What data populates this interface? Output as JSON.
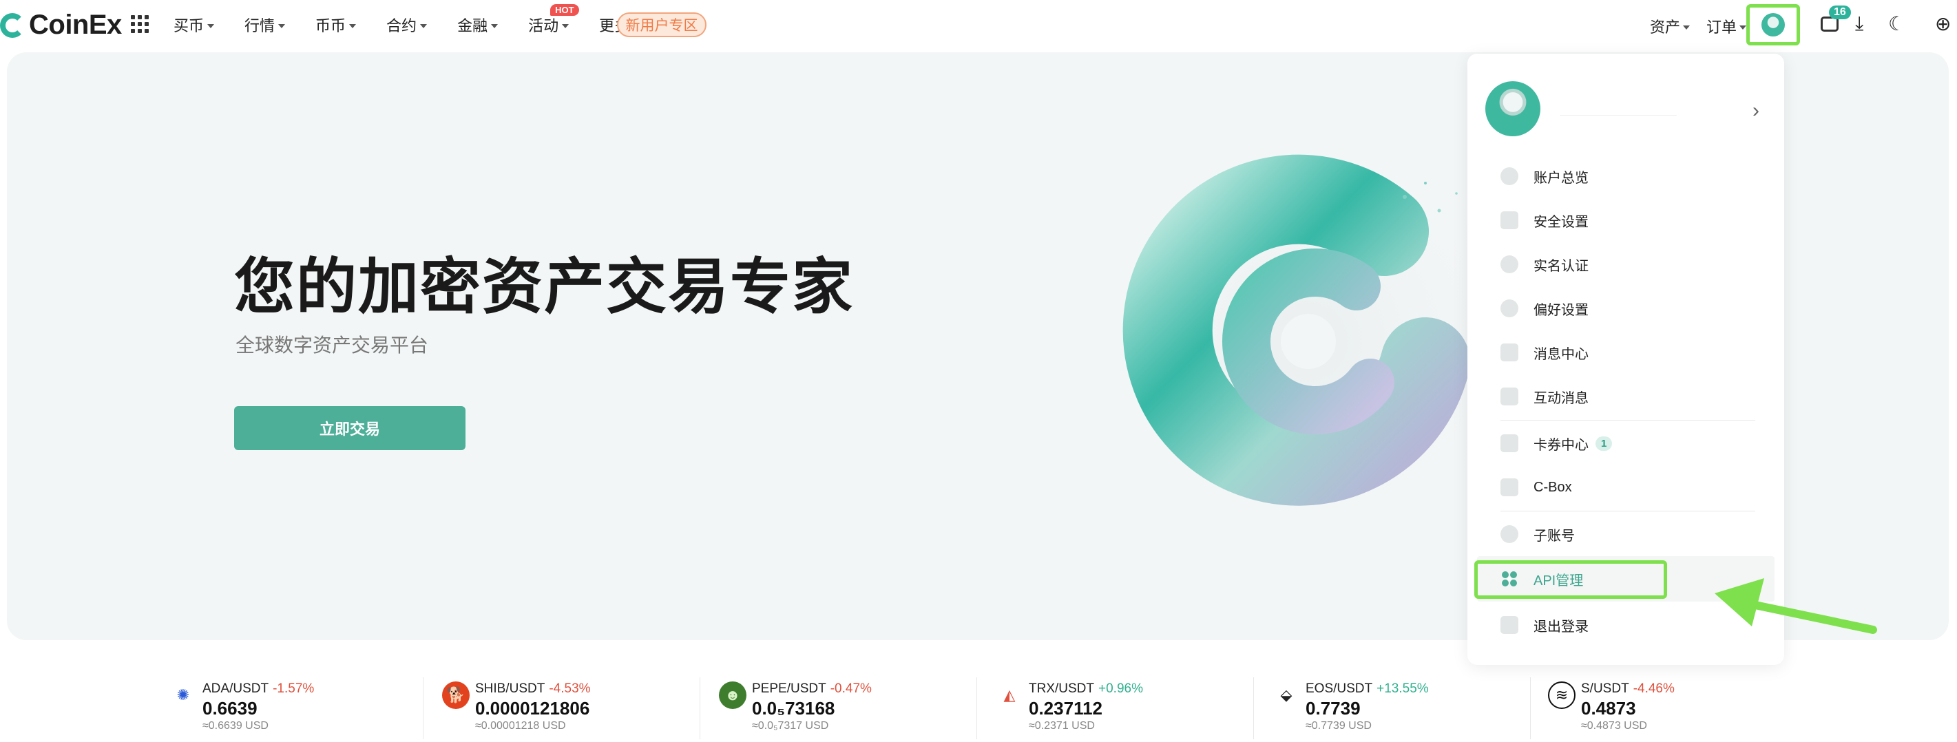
{
  "brand": {
    "name": "CoinEx"
  },
  "nav": {
    "items": [
      {
        "label": "买币"
      },
      {
        "label": "行情"
      },
      {
        "label": "币币"
      },
      {
        "label": "合约"
      },
      {
        "label": "金融"
      },
      {
        "label": "活动",
        "badge": "HOT"
      },
      {
        "label": "更多"
      }
    ],
    "promo": "新用户专区",
    "right": {
      "assets": "资产",
      "orders": "订单",
      "messages_count": "16"
    }
  },
  "hero": {
    "title": "您的加密资产交易专家",
    "subtitle": "全球数字资产交易平台",
    "cta": "立即交易"
  },
  "dropdown": {
    "items": [
      {
        "label": "账户总览",
        "icon": "account-overview-icon"
      },
      {
        "label": "安全设置",
        "icon": "security-shield-icon"
      },
      {
        "label": "实名认证",
        "icon": "identity-verification-icon"
      },
      {
        "label": "偏好设置",
        "icon": "preferences-icon"
      },
      {
        "label": "消息中心",
        "icon": "message-center-icon"
      },
      {
        "label": "互动消息",
        "icon": "interactive-message-icon"
      },
      {
        "label": "卡券中心",
        "icon": "coupon-center-icon",
        "badge": "1"
      },
      {
        "label": "C-Box",
        "icon": "c-box-icon"
      },
      {
        "label": "子账号",
        "icon": "sub-account-icon"
      },
      {
        "label": "API管理",
        "icon": "api-management-icon"
      },
      {
        "label": "退出登录",
        "icon": "logout-icon"
      }
    ]
  },
  "ticker": [
    {
      "pair": "ADA/USDT",
      "change": "-1.57%",
      "price": "0.6639",
      "usd": "≈0.6639 USD",
      "icon": "ada-coin-icon"
    },
    {
      "pair": "SHIB/USDT",
      "change": "-4.53%",
      "price": "0.0000121806",
      "usd": "≈0.00001218 USD",
      "icon": "shib-coin-icon"
    },
    {
      "pair": "PEPE/USDT",
      "change": "-0.47%",
      "price": "0.0₅73168",
      "usd": "≈0.0₅7317 USD",
      "icon": "pepe-coin-icon"
    },
    {
      "pair": "TRX/USDT",
      "change": "+0.96%",
      "price": "0.237112",
      "usd": "≈0.2371 USD",
      "icon": "trx-coin-icon"
    },
    {
      "pair": "EOS/USDT",
      "change": "+13.55%",
      "price": "0.7739",
      "usd": "≈0.7739 USD",
      "icon": "eos-coin-icon"
    },
    {
      "pair": "S/USDT",
      "change": "-4.46%",
      "price": "0.4873",
      "usd": "≈0.4873 USD",
      "icon": "s-coin-icon"
    }
  ],
  "colors": {
    "accent": "#4daf98",
    "highlight": "#7ee04c",
    "negative": "#e0503c",
    "positive": "#2fb08d",
    "promo": "#f07b45"
  }
}
